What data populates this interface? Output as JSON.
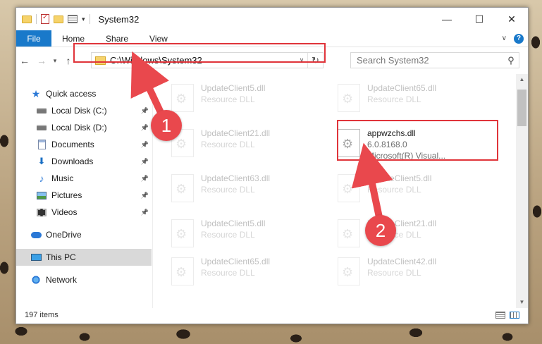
{
  "window": {
    "title": "System32"
  },
  "ribbon": {
    "file": "File",
    "tabs": [
      "Home",
      "Share",
      "View"
    ],
    "help": "?"
  },
  "nav": {
    "address": "C:\\Windows\\System32",
    "search_placeholder": "Search System32"
  },
  "sidebar": {
    "items": [
      {
        "label": "Quick access",
        "icon": "star-icon"
      },
      {
        "label": "Local Disk (C:)",
        "icon": "drive-icon",
        "pinned": true
      },
      {
        "label": "Local Disk (D:)",
        "icon": "drive-icon",
        "pinned": true
      },
      {
        "label": "Documents",
        "icon": "documents-icon",
        "pinned": true
      },
      {
        "label": "Downloads",
        "icon": "downloads-icon",
        "pinned": true
      },
      {
        "label": "Music",
        "icon": "music-icon",
        "pinned": true
      },
      {
        "label": "Pictures",
        "icon": "pictures-icon",
        "pinned": true
      },
      {
        "label": "Videos",
        "icon": "videos-icon",
        "pinned": true
      },
      {
        "label": "OneDrive",
        "icon": "onedrive-icon"
      },
      {
        "label": "This PC",
        "icon": "pc-icon",
        "selected": true
      },
      {
        "label": "Network",
        "icon": "network-icon"
      }
    ]
  },
  "files": [
    {
      "name": "UpdateClient5.dll",
      "sub1": "Resource DLL",
      "faded": true
    },
    {
      "name": "UpdateClient65.dll",
      "sub1": "Resource DLL",
      "faded": true
    },
    {
      "name": "UpdateClient21.dll",
      "sub1": "Resource DLL",
      "faded": true
    },
    {
      "name": "appwzchs.dll",
      "sub1": "6.0.8168.0",
      "sub2": "Microsoft(R) Visual...",
      "faded": false
    },
    {
      "name": "UpdateClient63.dll",
      "sub1": "Resource DLL",
      "faded": true
    },
    {
      "name": "UpdateClient5.dll",
      "sub1": "Resource DLL",
      "faded": true
    },
    {
      "name": "UpdateClient5.dll",
      "sub1": "Resource DLL",
      "faded": true
    },
    {
      "name": "UpdateClient21.dll",
      "sub1": "Resource DLL",
      "faded": true
    },
    {
      "name": "UpdateClient65.dll",
      "sub1": "Resource DLL",
      "faded": true
    },
    {
      "name": "UpdateClient42.dll",
      "sub1": "Resource DLL",
      "faded": true
    }
  ],
  "status": {
    "count": "197 items"
  },
  "annotations": {
    "step1": "1",
    "step2": "2",
    "color": "#e0343a"
  }
}
